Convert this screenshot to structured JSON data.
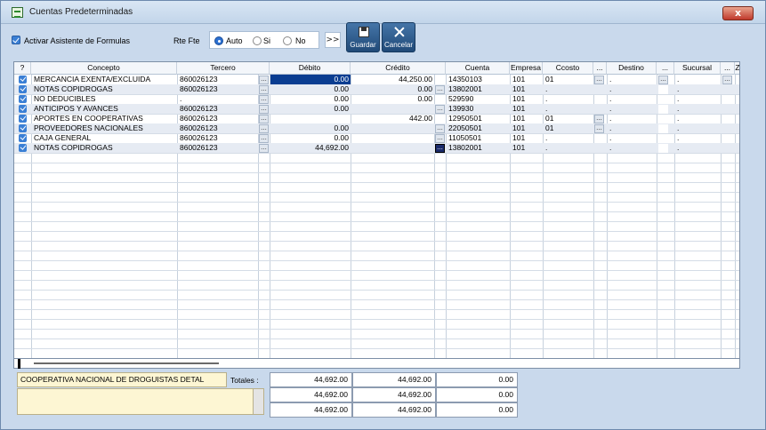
{
  "window": {
    "title": "Cuentas Predeterminadas",
    "close_label": "x"
  },
  "toolbar": {
    "assistant_label": "Activar Asistente de Formulas",
    "rte_fte_label": "Rte Fte",
    "radio_auto": "Auto",
    "radio_si": "Si",
    "radio_no": "No",
    "next_label": ">>",
    "save_label": "Guardar",
    "cancel_label": "Cancelar",
    "selected_radio": "Auto"
  },
  "grid": {
    "columns": [
      "?",
      "Concepto",
      "Tercero",
      "Débito",
      "Crédito",
      "Cuenta",
      "Empresa",
      "Ccosto",
      "...",
      "Destino",
      "...",
      "Sucursal",
      "...",
      "Z"
    ],
    "rows": [
      {
        "concepto": "MERCANCIA EXENTA/EXCLUIDA",
        "tercero": "860026123",
        "debito": "0.00",
        "credito": "44,250.00",
        "cuenta": "14350103",
        "empresa": "101",
        "ccosto": "01",
        "destino": ".",
        "sucursal": "."
      },
      {
        "concepto": "NOTAS COPIDROGAS",
        "tercero": "860026123",
        "debito": "0.00",
        "credito": "0.00",
        "cuenta": "13802001",
        "empresa": "101",
        "ccosto": ".",
        "destino": ".",
        "sucursal": "."
      },
      {
        "concepto": "NO DEDUCIBLES",
        "tercero": ".",
        "debito": "0.00",
        "credito": "0.00",
        "cuenta": "529590",
        "empresa": "101",
        "ccosto": ".",
        "destino": ".",
        "sucursal": "."
      },
      {
        "concepto": "ANTICIPOS Y AVANCES",
        "tercero": "860026123",
        "debito": "0.00",
        "credito": "",
        "cuenta": "139930",
        "empresa": "101",
        "ccosto": ".",
        "destino": ".",
        "sucursal": "."
      },
      {
        "concepto": "APORTES EN COOPERATIVAS",
        "tercero": "860026123",
        "debito": "",
        "credito": "442.00",
        "cuenta": "12950501",
        "empresa": "101",
        "ccosto": "01",
        "destino": ".",
        "sucursal": "."
      },
      {
        "concepto": "PROVEEDORES NACIONALES",
        "tercero": "860026123",
        "debito": "0.00",
        "credito": "",
        "cuenta": "22050501",
        "empresa": "101",
        "ccosto": "01",
        "destino": ".",
        "sucursal": "."
      },
      {
        "concepto": "CAJA GENERAL",
        "tercero": "860026123",
        "debito": "0.00",
        "credito": "",
        "cuenta": "11050501",
        "empresa": "101",
        "ccosto": ".",
        "destino": ".",
        "sucursal": "."
      },
      {
        "concepto": "NOTAS COPIDROGAS",
        "tercero": "860026123",
        "debito": "44,692.00",
        "credito": "",
        "cuenta": "13802001",
        "empresa": "101",
        "ccosto": ".",
        "destino": ".",
        "sucursal": "."
      }
    ]
  },
  "footer": {
    "company": "COOPERATIVA NACIONAL DE DROGUISTAS DETAL",
    "totals_label": "Totales :",
    "totals": [
      {
        "debito": "44,692.00",
        "credito": "44,692.00",
        "diferencia": "0.00"
      },
      {
        "debito": "44,692.00",
        "credito": "44,692.00",
        "diferencia": "0.00"
      },
      {
        "debito": "44,692.00",
        "credito": "44,692.00",
        "diferencia": "0.00"
      }
    ]
  }
}
